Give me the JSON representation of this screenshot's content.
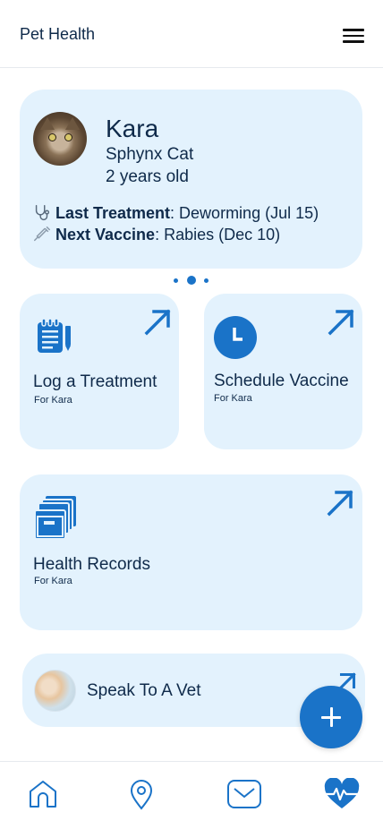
{
  "header": {
    "title": "Pet Health",
    "menu_icon": "hamburger-menu-icon"
  },
  "pet": {
    "name": "Kara",
    "breed": "Sphynx Cat",
    "age": "2 years old",
    "last_treatment_label": "Last Treatment",
    "last_treatment_value": ": Deworming (Jul 15)",
    "next_vaccine_label": "Next Vaccine",
    "next_vaccine_value": ": Rabies (Dec 10)",
    "icons": [
      "stethoscope-icon",
      "syringe-icon"
    ]
  },
  "carousel": {
    "count": 3,
    "active": 1
  },
  "tiles": {
    "log": {
      "title": "Log a Treatment",
      "sub": "For Kara",
      "icon": "clipboard-icon"
    },
    "schedule": {
      "title": "Schedule Vaccine",
      "sub": "For Kara",
      "icon": "clock-icon"
    },
    "records": {
      "title": "Health Records",
      "sub": "For Kara",
      "icon": "file-cabinet-icon"
    }
  },
  "vet": {
    "label": "Speak To A Vet"
  },
  "fab": {
    "icon": "plus-icon"
  },
  "bottom_nav": {
    "items": [
      {
        "name": "home",
        "icon": "home-icon",
        "active": false
      },
      {
        "name": "location",
        "icon": "map-pin-icon",
        "active": false
      },
      {
        "name": "messages",
        "icon": "envelope-icon",
        "active": false
      },
      {
        "name": "health",
        "icon": "heart-pulse-icon",
        "active": true
      }
    ]
  },
  "colors": {
    "accent": "#1a73c8",
    "card_bg": "#e3f2fd",
    "text": "#0f2a4a"
  }
}
